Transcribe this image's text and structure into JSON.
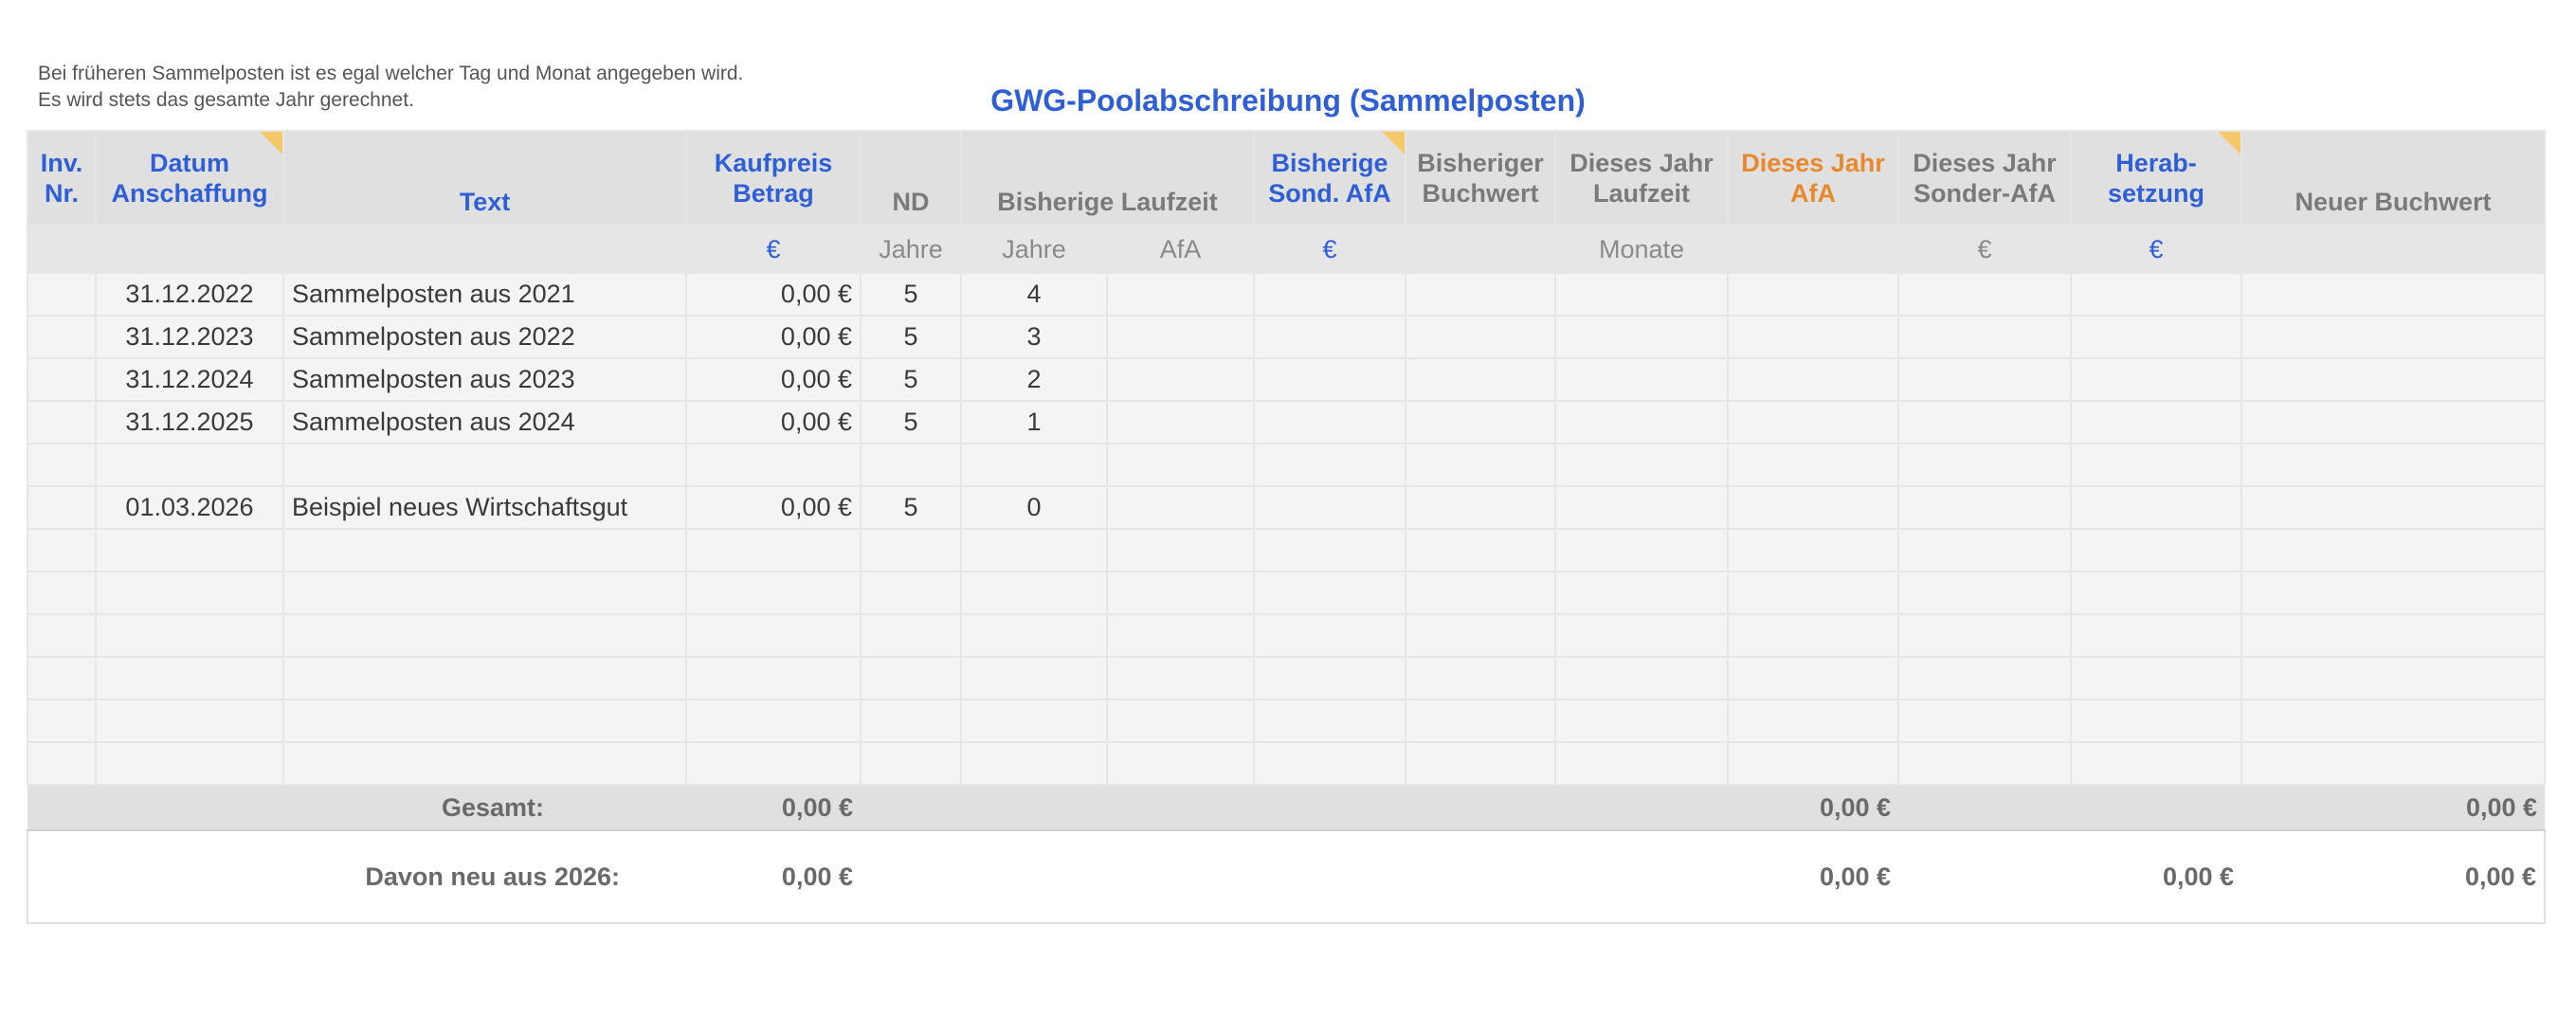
{
  "note": {
    "line1": "Bei früheren Sammelposten ist es egal welcher Tag und Monat angegeben wird.",
    "line2": "Es wird stets das gesamte Jahr gerechnet."
  },
  "title": "GWG-Poolabschreibung (Sammelposten)",
  "headers": {
    "inv": "Inv. Nr.",
    "datum": "Datum Anschaffung",
    "text": "Text",
    "kaufpreis": "Kaufpreis Betrag",
    "nd": "ND",
    "laufzeit": "Bisherige Laufzeit",
    "sond_afa": "Bisherige Sond. AfA",
    "buchwert": "Bisheriger Buchwert",
    "jahr_laufzeit": "Dieses Jahr Laufzeit",
    "jahr_afa": "Dieses Jahr AfA",
    "jahr_sonder": "Dieses Jahr Sonder-AfA",
    "herab": "Herab- setzung",
    "neuer": "Neuer Buchwert"
  },
  "units": {
    "kaufpreis": "€",
    "nd": "Jahre",
    "laufzeit_jahre": "Jahre",
    "laufzeit_afa": "AfA",
    "sond_afa": "€",
    "jahr_laufzeit": "Monate",
    "jahr_sonder": "€",
    "herab": "€"
  },
  "rows": [
    {
      "datum": "31.12.2022",
      "text": "Sammelposten aus 2021",
      "betrag": "0,00 €",
      "nd": "5",
      "jahre": "4"
    },
    {
      "datum": "31.12.2023",
      "text": "Sammelposten aus 2022",
      "betrag": "0,00 €",
      "nd": "5",
      "jahre": "3"
    },
    {
      "datum": "31.12.2024",
      "text": "Sammelposten aus 2023",
      "betrag": "0,00 €",
      "nd": "5",
      "jahre": "2"
    },
    {
      "datum": "31.12.2025",
      "text": "Sammelposten aus 2024",
      "betrag": "0,00 €",
      "nd": "5",
      "jahre": "1"
    },
    {
      "datum": "",
      "text": "",
      "betrag": "",
      "nd": "",
      "jahre": ""
    },
    {
      "datum": "01.03.2026",
      "text": "Beispiel neues Wirtschaftsgut",
      "betrag": "0,00 €",
      "nd": "5",
      "jahre": "0"
    },
    {
      "datum": "",
      "text": "",
      "betrag": "",
      "nd": "",
      "jahre": ""
    },
    {
      "datum": "",
      "text": "",
      "betrag": "",
      "nd": "",
      "jahre": ""
    },
    {
      "datum": "",
      "text": "",
      "betrag": "",
      "nd": "",
      "jahre": ""
    },
    {
      "datum": "",
      "text": "",
      "betrag": "",
      "nd": "",
      "jahre": ""
    },
    {
      "datum": "",
      "text": "",
      "betrag": "",
      "nd": "",
      "jahre": ""
    },
    {
      "datum": "",
      "text": "",
      "betrag": "",
      "nd": "",
      "jahre": ""
    }
  ],
  "total": {
    "label": "Gesamt:",
    "kaufpreis": "0,00 €",
    "jahr_afa": "0,00 €",
    "neuer": "0,00 €"
  },
  "neu": {
    "label": "Davon neu aus 2026:",
    "kaufpreis": "0,00 €",
    "jahr_afa": "0,00 €",
    "herab": "0,00 €",
    "neuer": "0,00 €"
  },
  "colors": {
    "accent_blue": "#2f5fd6",
    "accent_orange": "#e8892e",
    "header_gray": "#e0e0e0",
    "comment_flag": "#f5c86a"
  }
}
